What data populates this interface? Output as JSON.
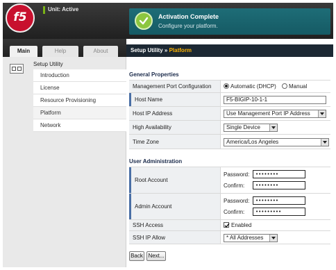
{
  "header": {
    "logo_text": "f5",
    "unit_status": "Unit: Active",
    "activation_title": "Activation Complete",
    "activation_subtitle": "Configure your platform.",
    "colors": {
      "brand": "#c8102e",
      "status": "#7ab317",
      "banner": "#1e6d77",
      "check": "#8cc63f"
    }
  },
  "tabs": [
    {
      "label": "Main",
      "active": true
    },
    {
      "label": "Help",
      "active": false
    },
    {
      "label": "About",
      "active": false
    }
  ],
  "nav": {
    "title": "Setup Utility",
    "icon": "setup-utility-icon",
    "items": [
      {
        "label": "Introduction"
      },
      {
        "label": "License"
      },
      {
        "label": "Resource Provisioning"
      },
      {
        "label": "Platform",
        "selected": true
      },
      {
        "label": "Network"
      }
    ]
  },
  "breadcrumb": {
    "parent": "Setup Utility",
    "separator": "»",
    "current": "Platform"
  },
  "general": {
    "heading": "General Properties",
    "mgmt_port": {
      "label": "Management Port Configuration",
      "option_auto": "Automatic (DHCP)",
      "option_manual": "Manual",
      "selected": "auto"
    },
    "host_name": {
      "label": "Host Name",
      "value": "F5-BIGIP-10-1-1"
    },
    "host_ip": {
      "label": "Host IP Address",
      "value": "Use Management Port IP Address"
    },
    "high_availability": {
      "label": "High Availability",
      "value": "Single Device"
    },
    "time_zone": {
      "label": "Time Zone",
      "value": "America/Los Angeles"
    }
  },
  "user_admin": {
    "heading": "User Administration",
    "password_label": "Password:",
    "confirm_label": "Confirm:",
    "root": {
      "label": "Root Account",
      "password": "••••••••",
      "confirm": "••••••••"
    },
    "admin": {
      "label": "Admin Account",
      "password": "••••••••",
      "confirm": "•••••••••"
    },
    "ssh_access": {
      "label": "SSH Access",
      "checkbox_label": "Enabled",
      "checked": true
    },
    "ssh_ip_allow": {
      "label": "SSH IP Allow",
      "value": "* All Addresses"
    }
  },
  "buttons": {
    "back": "Back",
    "next": "Next..."
  }
}
